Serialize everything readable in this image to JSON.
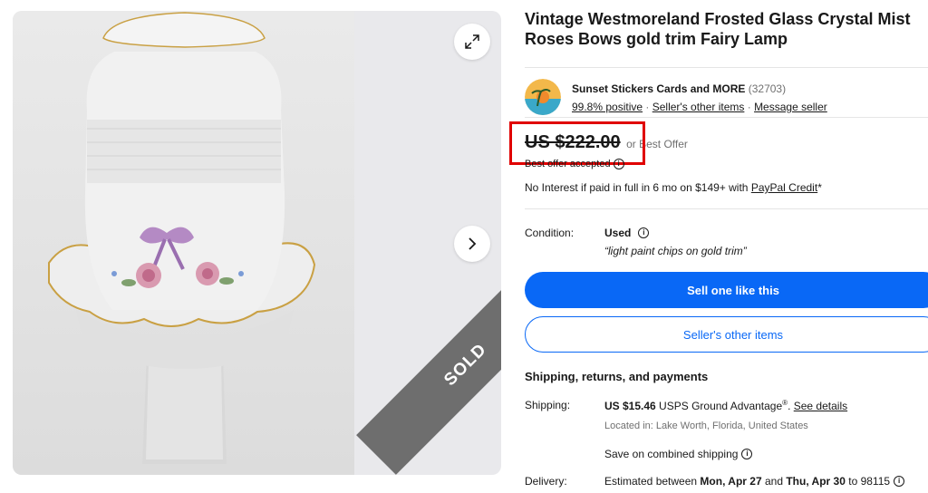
{
  "listing": {
    "title": "Vintage Westmoreland Frosted Glass Crystal Mist Roses Bows gold trim Fairy Lamp"
  },
  "gallery": {
    "sold_label": "SOLD",
    "expand_icon": "expand-icon",
    "next_icon": "chevron-right-icon"
  },
  "seller": {
    "name": "Sunset Stickers Cards and MORE",
    "feedback_count": "(32703)",
    "positive": "99.8% positive",
    "sep1": " · ",
    "other_items": "Seller's other items",
    "sep2": " · ",
    "message": "Message seller"
  },
  "price": {
    "amount": "US $222.00",
    "best_offer": "or Best Offer",
    "offer_accepted": "Best offer accepted",
    "financing_text": "No Interest if paid in full in 6 mo on $149+ with ",
    "financing_link": "PayPal Credit",
    "financing_suffix": "*"
  },
  "condition": {
    "label": "Condition:",
    "value": "Used",
    "note": "“light paint chips on gold trim”"
  },
  "actions": {
    "sell_like": "Sell one like this",
    "other_items": "Seller's other items"
  },
  "shipping": {
    "heading": "Shipping, returns, and payments",
    "label": "Shipping:",
    "cost": "US $15.46",
    "service": " USPS Ground Advantage",
    "registered": "®",
    "sep": ". ",
    "details_link": "See details",
    "location": "Located in: Lake Worth, Florida, United States",
    "combined": "Save on combined shipping"
  },
  "delivery": {
    "label": "Delivery:",
    "prefix": "Estimated between ",
    "start": "Mon, Apr 27",
    "and": " and ",
    "end": "Thu, Apr 30",
    "to": " to 98115"
  },
  "colors": {
    "accent": "#0968f6",
    "highlight_box": "#e00000",
    "sold_band": "#6e6e6e"
  }
}
